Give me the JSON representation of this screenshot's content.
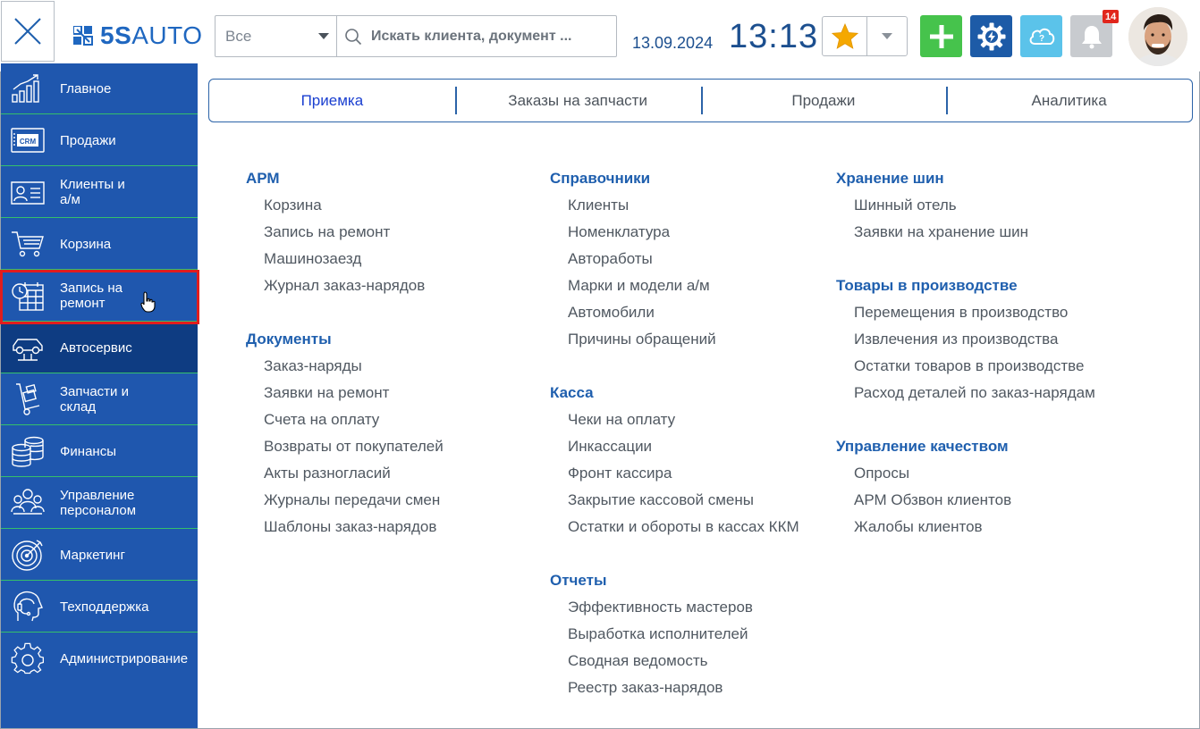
{
  "header": {
    "logo_text_bold": "5S",
    "logo_text_light": "AUTO",
    "search_scope": "Все",
    "search_placeholder": "Искать клиента, документ ...",
    "date": "13.09.2024",
    "time": "13:13",
    "notification_count": "14"
  },
  "sidebar": {
    "items": [
      {
        "label": "Главное",
        "icon": "chart-icon"
      },
      {
        "label": "Продажи",
        "icon": "crm-icon"
      },
      {
        "label": "Клиенты и\nа/м",
        "icon": "client-card-icon"
      },
      {
        "label": "Корзина",
        "icon": "cart-icon"
      },
      {
        "label": "Запись на\nремонт",
        "icon": "calendar-clock-icon"
      },
      {
        "label": "Автосервис",
        "icon": "car-lift-icon"
      },
      {
        "label": "Запчасти и\nсклад",
        "icon": "parts-cart-icon"
      },
      {
        "label": "Финансы",
        "icon": "coins-icon"
      },
      {
        "label": "Управление\nперсоналом",
        "icon": "people-icon"
      },
      {
        "label": "Маркетинг",
        "icon": "target-icon"
      },
      {
        "label": "Техподдержка",
        "icon": "headset-icon"
      },
      {
        "label": "Администрирование",
        "icon": "gear-icon"
      }
    ]
  },
  "tabs": [
    "Приемка",
    "Заказы на запчасти",
    "Продажи",
    "Аналитика"
  ],
  "columns": [
    {
      "sections": [
        {
          "title": "АРМ",
          "links": [
            "Корзина",
            "Запись на ремонт",
            "Машинозаезд",
            "Журнал заказ-нарядов"
          ]
        },
        {
          "title": "Документы",
          "links": [
            "Заказ-наряды",
            "Заявки на ремонт",
            "Счета на оплату",
            "Возвраты от покупателей",
            "Акты разногласий",
            "Журналы передачи смен",
            "Шаблоны заказ-нарядов"
          ]
        }
      ]
    },
    {
      "sections": [
        {
          "title": "Справочники",
          "links": [
            "Клиенты",
            "Номенклатура",
            "Автоработы",
            "Марки и модели а/м",
            "Автомобили",
            "Причины обращений"
          ]
        },
        {
          "title": "Касса",
          "links": [
            "Чеки на оплату",
            "Инкассации",
            "Фронт кассира",
            "Закрытие кассовой смены",
            "Остатки и обороты в кассах ККМ"
          ]
        },
        {
          "title": "Отчеты",
          "links": [
            "Эффективность мастеров",
            "Выработка исполнителей",
            "Сводная ведомость",
            "Реестр заказ-нарядов"
          ]
        }
      ]
    },
    {
      "sections": [
        {
          "title": "Хранение шин",
          "links": [
            "Шинный отель",
            "Заявки на хранение шин"
          ]
        },
        {
          "title": "Товары в производстве",
          "links": [
            "Перемещения в производство",
            "Извлечения из производства",
            "Остатки товаров в производстве",
            "Расход деталей по заказ-нарядам"
          ]
        },
        {
          "title": "Управление качеством",
          "links": [
            "Опросы",
            "АРМ Обзвон клиентов",
            "Жалобы клиентов"
          ]
        }
      ]
    }
  ],
  "colors": {
    "sidebar": "#1f57ae",
    "sidebar_active": "#0e3c82",
    "sidebar_divider": "#35c06a",
    "accent": "#1f5fae",
    "highlight": "#e11d1d"
  }
}
